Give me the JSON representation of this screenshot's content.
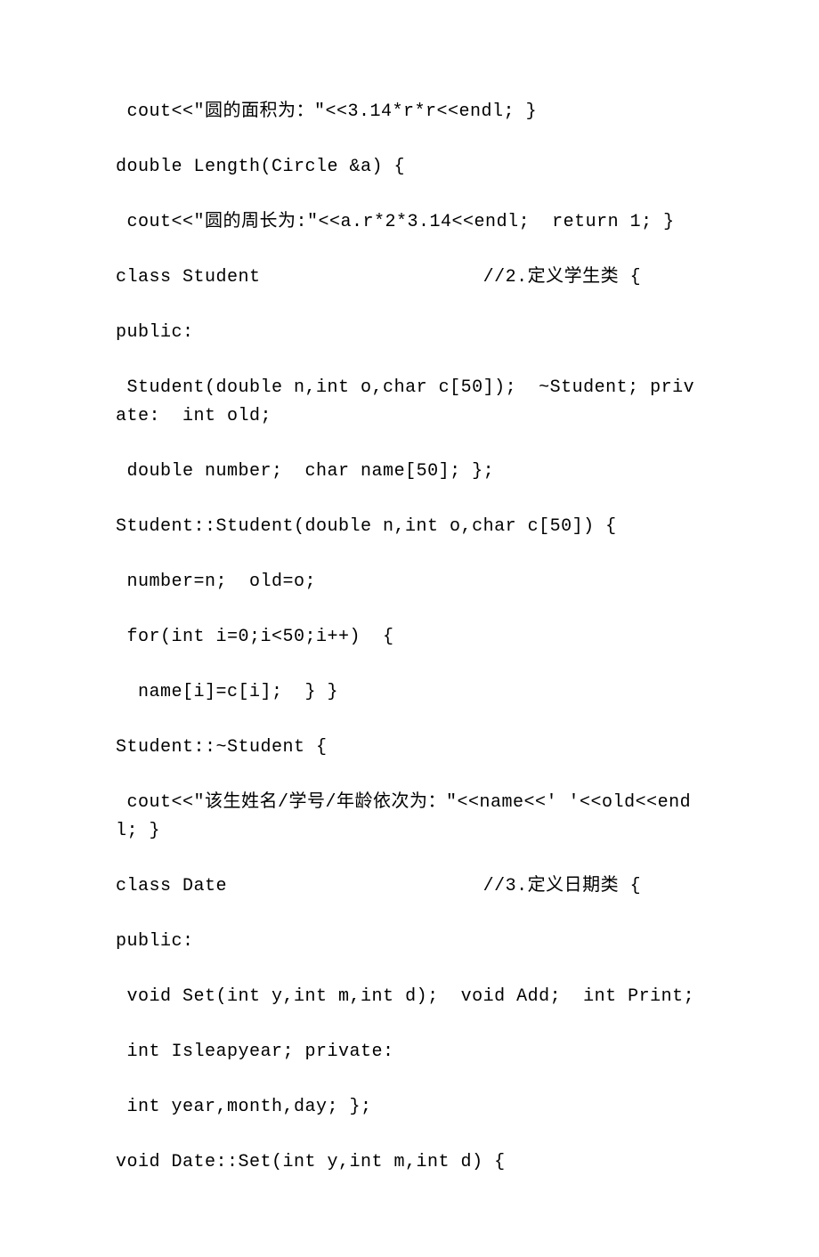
{
  "lines": [
    {
      "text": " cout<<\"圆的面积为：\"<<3.14*r*r<<endl; }",
      "indent": 0
    },
    {
      "text": "double Length(Circle &a) {",
      "indent": 0
    },
    {
      "text": " cout<<\"圆的周长为:\"<<a.r*2*3.14<<endl;  return 1; }",
      "indent": 0
    },
    {
      "text": "class Student                    //2.定义学生类 {",
      "indent": 0
    },
    {
      "text": "public:",
      "indent": 0
    },
    {
      "text": " Student(double n,int o,char c[50]);  ~Student; private:  int old;",
      "indent": 0
    },
    {
      "text": " double number;  char name[50]; };",
      "indent": 0
    },
    {
      "text": "Student::Student(double n,int o,char c[50]) {",
      "indent": 0
    },
    {
      "text": " number=n;  old=o;",
      "indent": 0
    },
    {
      "text": " for(int i=0;i<50;i++)  {",
      "indent": 0
    },
    {
      "text": "  name[i]=c[i];  } }",
      "indent": 0
    },
    {
      "text": "Student::~Student {",
      "indent": 0
    },
    {
      "text": " cout<<\"该生姓名/学号/年龄依次为：\"<<name<<' '<<old<<endl; }",
      "indent": 0
    },
    {
      "text": "class Date                       //3.定义日期类 {",
      "indent": 0
    },
    {
      "text": "public:",
      "indent": 0
    },
    {
      "text": " void Set(int y,int m,int d);  void Add;  int Print;",
      "indent": 0
    },
    {
      "text": " int Isleapyear; private:",
      "indent": 0
    },
    {
      "text": " int year,month,day; };",
      "indent": 0
    },
    {
      "text": "void Date::Set(int y,int m,int d) {",
      "indent": 0
    }
  ]
}
